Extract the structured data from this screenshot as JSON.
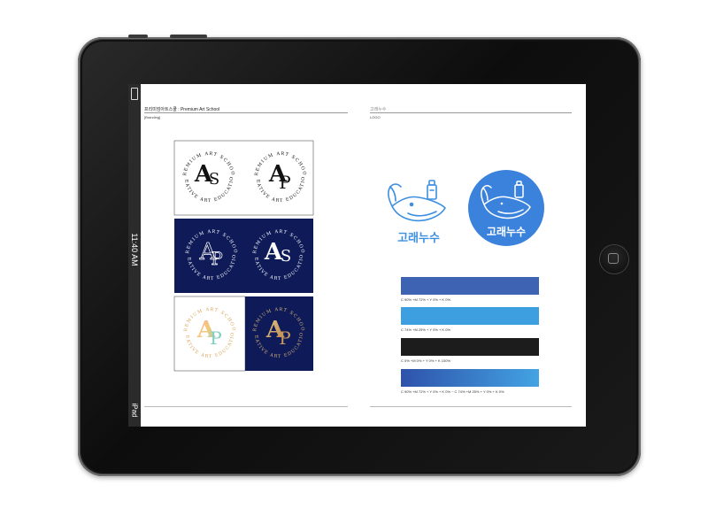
{
  "device": {
    "status_time": "11:40 AM",
    "device_label": "iPad"
  },
  "left_page": {
    "header_title": "프리미엄아트스쿨 : Premium Art School",
    "header_sub": "[Branding]",
    "logo": {
      "monogram_a": "A",
      "monogram_s": "S",
      "monogram_p": "P",
      "ring_top": "PREMIUM ART SCHOOL",
      "ring_bottom": "CREATIVE ART EDUCATION"
    }
  },
  "right_page": {
    "header_title": "고래누수",
    "header_sub": "LOGO",
    "wordmark": "고래누수",
    "colors": {
      "swatch1": "#3f63b3",
      "swatch2": "#3d9ee0",
      "swatch3": "#1c1c1c",
      "swatch4_from": "#2e52aa",
      "swatch4_to": "#43a3e3",
      "logo_blue": "#3d8fe0",
      "badge_blue": "#3a82dc",
      "navy": "#101f5c"
    },
    "swatch_labels": [
      "C 90% +M 72% + Y 0% + K 0%",
      "C 74% +M 25% + Y 0% + K 0%",
      "C 0% +M 0% + Y 0% + K 100%",
      "C 90% +M 72% + Y 0% + K 0% ~ C 74% +M 25% + Y 0% + K 0%"
    ]
  }
}
